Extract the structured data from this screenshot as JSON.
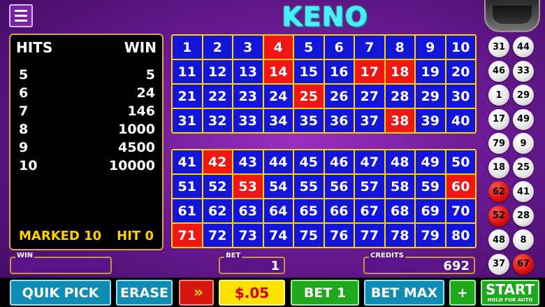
{
  "logo": "KENO",
  "paytable": {
    "hits_label": "HITS",
    "win_label": "WIN",
    "rows": [
      {
        "hits": "5",
        "win": "5"
      },
      {
        "hits": "6",
        "win": "24"
      },
      {
        "hits": "7",
        "win": "146"
      },
      {
        "hits": "8",
        "win": "1000"
      },
      {
        "hits": "9",
        "win": "4500"
      },
      {
        "hits": "10",
        "win": "10000"
      }
    ],
    "marked": "MARKED 10",
    "hit": "HIT 0"
  },
  "drawn_numbers": [
    4,
    14,
    17,
    18,
    25,
    38,
    42,
    53,
    60,
    71
  ],
  "balls": [
    {
      "n": "31",
      "red": false
    },
    {
      "n": "44",
      "red": false
    },
    {
      "n": "46",
      "red": false
    },
    {
      "n": "33",
      "red": false
    },
    {
      "n": "1",
      "red": false
    },
    {
      "n": "29",
      "red": false
    },
    {
      "n": "17",
      "red": false
    },
    {
      "n": "49",
      "red": false
    },
    {
      "n": "79",
      "red": false
    },
    {
      "n": "9",
      "red": false
    },
    {
      "n": "18",
      "red": false
    },
    {
      "n": "25",
      "red": false
    },
    {
      "n": "62",
      "red": true
    },
    {
      "n": "41",
      "red": false
    },
    {
      "n": "52",
      "red": true
    },
    {
      "n": "28",
      "red": false
    },
    {
      "n": "48",
      "red": false
    },
    {
      "n": "8",
      "red": false
    },
    {
      "n": "37",
      "red": false
    },
    {
      "n": "67",
      "red": true
    }
  ],
  "fields": {
    "win_label": "WIN",
    "win_value": "",
    "bet_label": "BET",
    "bet_value": "1",
    "credits_label": "CREDITS",
    "credits_value": "692"
  },
  "buttons": {
    "quick_pick": "QUIK PICK",
    "erase": "ERASE",
    "speed": "»",
    "denom": "$.05",
    "bet_one": "BET 1",
    "bet_max": "BET MAX",
    "plus": "+",
    "start": "START",
    "start_sub": "HOLD FOR AUTO"
  },
  "colors": {
    "cell_blue": "#1316d8",
    "cell_red": "#f01612",
    "grid_border": "#ffd400",
    "accent_yellow": "#ffd000"
  }
}
